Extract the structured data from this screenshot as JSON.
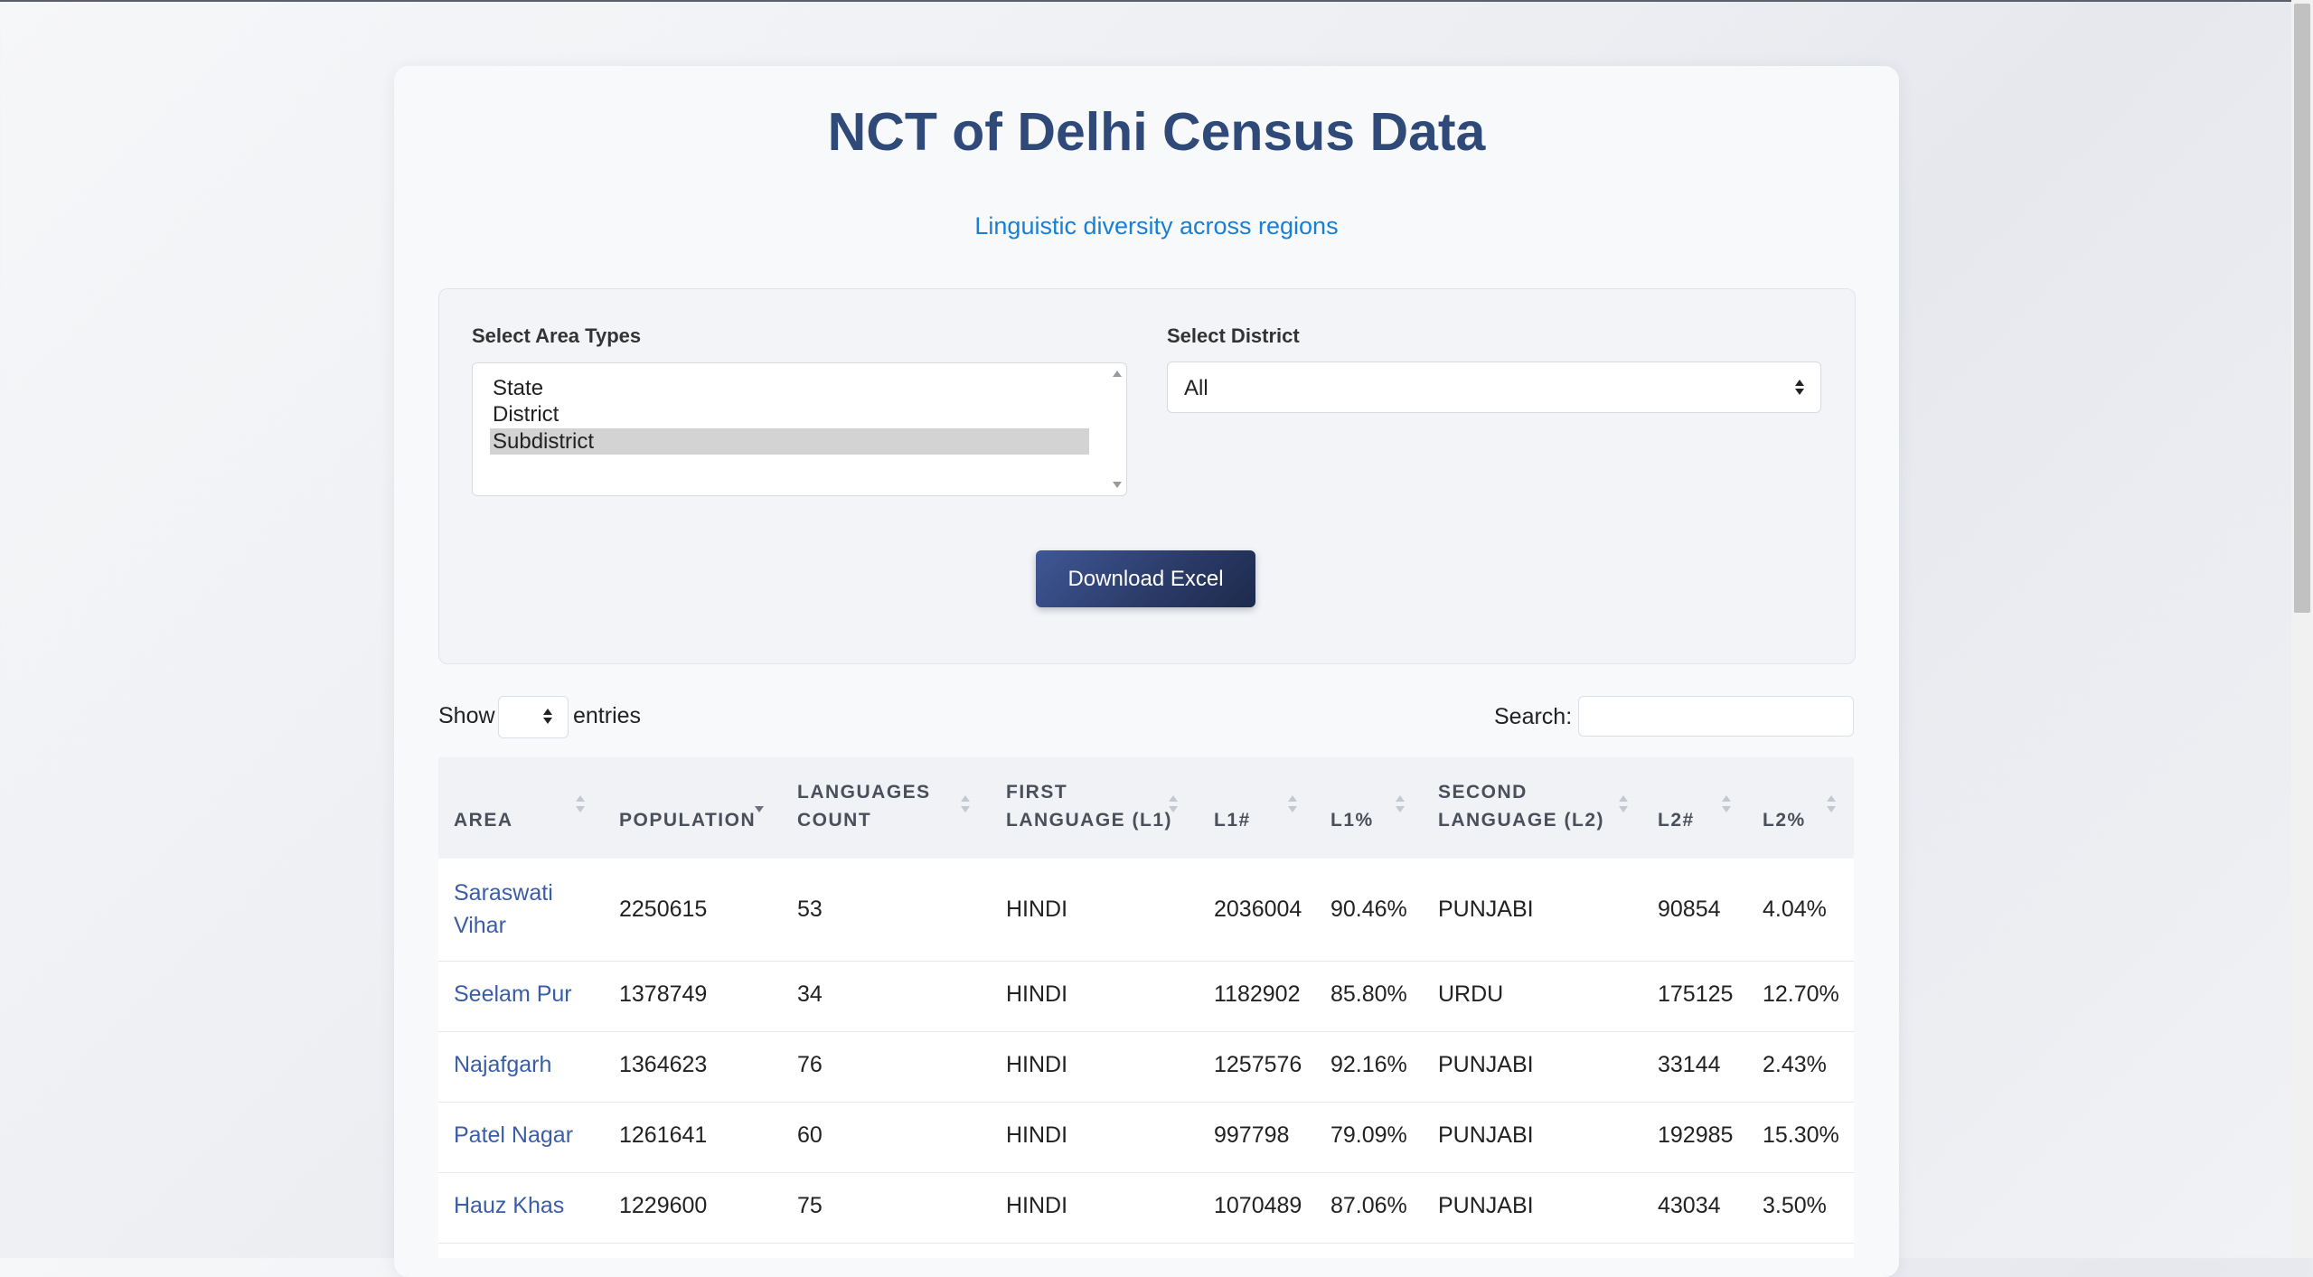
{
  "page": {
    "title": "NCT of Delhi Census Data",
    "subtitle": "Linguistic diversity across regions"
  },
  "filters": {
    "area_types_label": "Select Area Types",
    "area_types": [
      "State",
      "District",
      "Subdistrict"
    ],
    "area_types_selected": "Subdistrict",
    "district_label": "Select District",
    "district_value": "All",
    "download_label": "Download Excel"
  },
  "table_controls": {
    "show_label": "Show",
    "entries_label": "entries",
    "page_length_value": "",
    "search_label": "Search:",
    "search_value": ""
  },
  "table": {
    "columns": [
      {
        "label": "AREA",
        "label2": ""
      },
      {
        "label": "POPULATION",
        "label2": ""
      },
      {
        "label": "LANGUAGES",
        "label2": "COUNT"
      },
      {
        "label": "FIRST",
        "label2": "LANGUAGE (L1)"
      },
      {
        "label": "L1#",
        "label2": ""
      },
      {
        "label": "L1%",
        "label2": ""
      },
      {
        "label": "SECOND",
        "label2": "LANGUAGE (L2)"
      },
      {
        "label": "L2#",
        "label2": ""
      },
      {
        "label": "L2%",
        "label2": ""
      }
    ],
    "sorted_column": "POPULATION",
    "sort_direction": "desc",
    "rows": [
      {
        "area": "Saraswati",
        "area2": "Vihar",
        "population": "2250615",
        "languages_count": "53",
        "l1": "HINDI",
        "l1_num": "2036004",
        "l1_pct": "90.46%",
        "l2": "PUNJABI",
        "l2_num": "90854",
        "l2_pct": "4.04%"
      },
      {
        "area": "Seelam Pur",
        "area2": "",
        "population": "1378749",
        "languages_count": "34",
        "l1": "HINDI",
        "l1_num": "1182902",
        "l1_pct": "85.80%",
        "l2": "URDU",
        "l2_num": "175125",
        "l2_pct": "12.70%"
      },
      {
        "area": "Najafgarh",
        "area2": "",
        "population": "1364623",
        "languages_count": "76",
        "l1": "HINDI",
        "l1_num": "1257576",
        "l1_pct": "92.16%",
        "l2": "PUNJABI",
        "l2_num": "33144",
        "l2_pct": "2.43%"
      },
      {
        "area": "Patel Nagar",
        "area2": "",
        "population": "1261641",
        "languages_count": "60",
        "l1": "HINDI",
        "l1_num": "997798",
        "l1_pct": "79.09%",
        "l2": "PUNJABI",
        "l2_num": "192985",
        "l2_pct": "15.30%"
      },
      {
        "area": "Hauz Khas",
        "area2": "",
        "population": "1229600",
        "languages_count": "75",
        "l1": "HINDI",
        "l1_num": "1070489",
        "l1_pct": "87.06%",
        "l2": "PUNJABI",
        "l2_num": "43034",
        "l2_pct": "3.50%"
      }
    ]
  },
  "colors": {
    "title": "#2f4a79",
    "subtitle": "#1a7fd4",
    "link": "#3a5da8",
    "button": "#2a3a66"
  }
}
